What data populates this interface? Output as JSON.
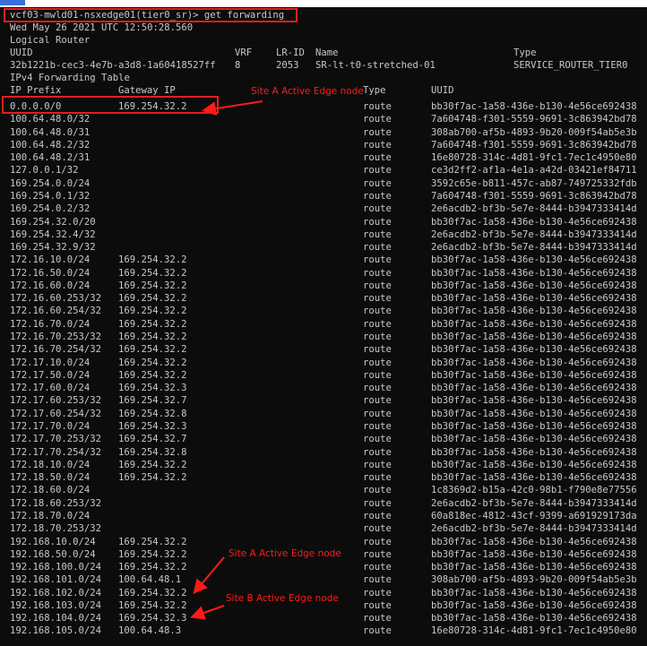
{
  "terminal": {
    "prompt": "vcf03-mwld01-nsxedge01(tier0_sr)> get forwarding",
    "timestamp": "Wed May 26 2021 UTC 12:50:28.560",
    "section_title": "Logical Router",
    "router_header": {
      "uuid": "UUID",
      "vrf": "VRF",
      "lrid": "LR-ID",
      "name": "Name",
      "type": "Type"
    },
    "router": {
      "uuid": "32b1221b-cec3-4e7b-a3d8-1a60418527ff",
      "vrf": "8",
      "lrid": "2053",
      "name": "SR-lt-t0-stretched-01",
      "type": "SERVICE_ROUTER_TIER0"
    },
    "table_title": "IPv4 Forwarding Table",
    "columns": {
      "prefix": "IP Prefix",
      "gateway": "Gateway IP",
      "type": "Type",
      "uuid": "UUID"
    },
    "rows": [
      {
        "prefix": "0.0.0.0/0",
        "gateway": "169.254.32.2",
        "type": "route",
        "uuid": "bb30f7ac-1a58-436e-b130-4e56ce692438"
      },
      {
        "prefix": "100.64.48.0/32",
        "gateway": "",
        "type": "route",
        "uuid": "7a604748-f301-5559-9691-3c863942bd78"
      },
      {
        "prefix": "100.64.48.0/31",
        "gateway": "",
        "type": "route",
        "uuid": "308ab700-af5b-4893-9b20-009f54ab5e3b"
      },
      {
        "prefix": "100.64.48.2/32",
        "gateway": "",
        "type": "route",
        "uuid": "7a604748-f301-5559-9691-3c863942bd78"
      },
      {
        "prefix": "100.64.48.2/31",
        "gateway": "",
        "type": "route",
        "uuid": "16e80728-314c-4d81-9fc1-7ec1c4950e80"
      },
      {
        "prefix": "127.0.0.1/32",
        "gateway": "",
        "type": "route",
        "uuid": "ce3d2ff2-af1a-4e1a-a42d-03421ef84711"
      },
      {
        "prefix": "169.254.0.0/24",
        "gateway": "",
        "type": "route",
        "uuid": "3592c65e-b811-457c-ab87-749725332fdb"
      },
      {
        "prefix": "169.254.0.1/32",
        "gateway": "",
        "type": "route",
        "uuid": "7a604748-f301-5559-9691-3c863942bd78"
      },
      {
        "prefix": "169.254.0.2/32",
        "gateway": "",
        "type": "route",
        "uuid": "2e6acdb2-bf3b-5e7e-8444-b3947333414d"
      },
      {
        "prefix": "169.254.32.0/20",
        "gateway": "",
        "type": "route",
        "uuid": "bb30f7ac-1a58-436e-b130-4e56ce692438"
      },
      {
        "prefix": "169.254.32.4/32",
        "gateway": "",
        "type": "route",
        "uuid": "2e6acdb2-bf3b-5e7e-8444-b3947333414d"
      },
      {
        "prefix": "169.254.32.9/32",
        "gateway": "",
        "type": "route",
        "uuid": "2e6acdb2-bf3b-5e7e-8444-b3947333414d"
      },
      {
        "prefix": "172.16.10.0/24",
        "gateway": "169.254.32.2",
        "type": "route",
        "uuid": "bb30f7ac-1a58-436e-b130-4e56ce692438"
      },
      {
        "prefix": "172.16.50.0/24",
        "gateway": "169.254.32.2",
        "type": "route",
        "uuid": "bb30f7ac-1a58-436e-b130-4e56ce692438"
      },
      {
        "prefix": "172.16.60.0/24",
        "gateway": "169.254.32.2",
        "type": "route",
        "uuid": "bb30f7ac-1a58-436e-b130-4e56ce692438"
      },
      {
        "prefix": "172.16.60.253/32",
        "gateway": "169.254.32.2",
        "type": "route",
        "uuid": "bb30f7ac-1a58-436e-b130-4e56ce692438"
      },
      {
        "prefix": "172.16.60.254/32",
        "gateway": "169.254.32.2",
        "type": "route",
        "uuid": "bb30f7ac-1a58-436e-b130-4e56ce692438"
      },
      {
        "prefix": "172.16.70.0/24",
        "gateway": "169.254.32.2",
        "type": "route",
        "uuid": "bb30f7ac-1a58-436e-b130-4e56ce692438"
      },
      {
        "prefix": "172.16.70.253/32",
        "gateway": "169.254.32.2",
        "type": "route",
        "uuid": "bb30f7ac-1a58-436e-b130-4e56ce692438"
      },
      {
        "prefix": "172.16.70.254/32",
        "gateway": "169.254.32.2",
        "type": "route",
        "uuid": "bb30f7ac-1a58-436e-b130-4e56ce692438"
      },
      {
        "prefix": "172.17.10.0/24",
        "gateway": "169.254.32.2",
        "type": "route",
        "uuid": "bb30f7ac-1a58-436e-b130-4e56ce692438"
      },
      {
        "prefix": "172.17.50.0/24",
        "gateway": "169.254.32.2",
        "type": "route",
        "uuid": "bb30f7ac-1a58-436e-b130-4e56ce692438"
      },
      {
        "prefix": "172.17.60.0/24",
        "gateway": "169.254.32.3",
        "type": "route",
        "uuid": "bb30f7ac-1a58-436e-b130-4e56ce692438"
      },
      {
        "prefix": "172.17.60.253/32",
        "gateway": "169.254.32.7",
        "type": "route",
        "uuid": "bb30f7ac-1a58-436e-b130-4e56ce692438"
      },
      {
        "prefix": "172.17.60.254/32",
        "gateway": "169.254.32.8",
        "type": "route",
        "uuid": "bb30f7ac-1a58-436e-b130-4e56ce692438"
      },
      {
        "prefix": "172.17.70.0/24",
        "gateway": "169.254.32.3",
        "type": "route",
        "uuid": "bb30f7ac-1a58-436e-b130-4e56ce692438"
      },
      {
        "prefix": "172.17.70.253/32",
        "gateway": "169.254.32.7",
        "type": "route",
        "uuid": "bb30f7ac-1a58-436e-b130-4e56ce692438"
      },
      {
        "prefix": "172.17.70.254/32",
        "gateway": "169.254.32.8",
        "type": "route",
        "uuid": "bb30f7ac-1a58-436e-b130-4e56ce692438"
      },
      {
        "prefix": "172.18.10.0/24",
        "gateway": "169.254.32.2",
        "type": "route",
        "uuid": "bb30f7ac-1a58-436e-b130-4e56ce692438"
      },
      {
        "prefix": "172.18.50.0/24",
        "gateway": "169.254.32.2",
        "type": "route",
        "uuid": "bb30f7ac-1a58-436e-b130-4e56ce692438"
      },
      {
        "prefix": "172.18.60.0/24",
        "gateway": "",
        "type": "route",
        "uuid": "1c8369d2-b15a-42c0-98b1-f790e8e77556"
      },
      {
        "prefix": "172.18.60.253/32",
        "gateway": "",
        "type": "route",
        "uuid": "2e6acdb2-bf3b-5e7e-8444-b3947333414d"
      },
      {
        "prefix": "172.18.70.0/24",
        "gateway": "",
        "type": "route",
        "uuid": "60a818ec-4812-43cf-9399-a691929173da"
      },
      {
        "prefix": "172.18.70.253/32",
        "gateway": "",
        "type": "route",
        "uuid": "2e6acdb2-bf3b-5e7e-8444-b3947333414d"
      },
      {
        "prefix": "192.168.10.0/24",
        "gateway": "169.254.32.2",
        "type": "route",
        "uuid": "bb30f7ac-1a58-436e-b130-4e56ce692438"
      },
      {
        "prefix": "192.168.50.0/24",
        "gateway": "169.254.32.2",
        "type": "route",
        "uuid": "bb30f7ac-1a58-436e-b130-4e56ce692438"
      },
      {
        "prefix": "192.168.100.0/24",
        "gateway": "169.254.32.2",
        "type": "route",
        "uuid": "bb30f7ac-1a58-436e-b130-4e56ce692438"
      },
      {
        "prefix": "192.168.101.0/24",
        "gateway": "100.64.48.1",
        "type": "route",
        "uuid": "308ab700-af5b-4893-9b20-009f54ab5e3b"
      },
      {
        "prefix": "192.168.102.0/24",
        "gateway": "169.254.32.2",
        "type": "route",
        "uuid": "bb30f7ac-1a58-436e-b130-4e56ce692438"
      },
      {
        "prefix": "192.168.103.0/24",
        "gateway": "169.254.32.2",
        "type": "route",
        "uuid": "bb30f7ac-1a58-436e-b130-4e56ce692438"
      },
      {
        "prefix": "192.168.104.0/24",
        "gateway": "169.254.32.3",
        "type": "route",
        "uuid": "bb30f7ac-1a58-436e-b130-4e56ce692438"
      },
      {
        "prefix": "192.168.105.0/24",
        "gateway": "100.64.48.3",
        "type": "route",
        "uuid": "16e80728-314c-4d81-9fc1-7ec1c4950e80"
      }
    ]
  },
  "annotations": {
    "site_a_1": "Site A Active Edge node",
    "site_a_2": "Site A Active Edge node",
    "site_b": "Site B Active Edge node"
  },
  "colors": {
    "terminal_bg": "#0c0c0c",
    "text": "#c8c8c8",
    "highlight": "#e0201e",
    "accent": "#3a6fd8"
  }
}
